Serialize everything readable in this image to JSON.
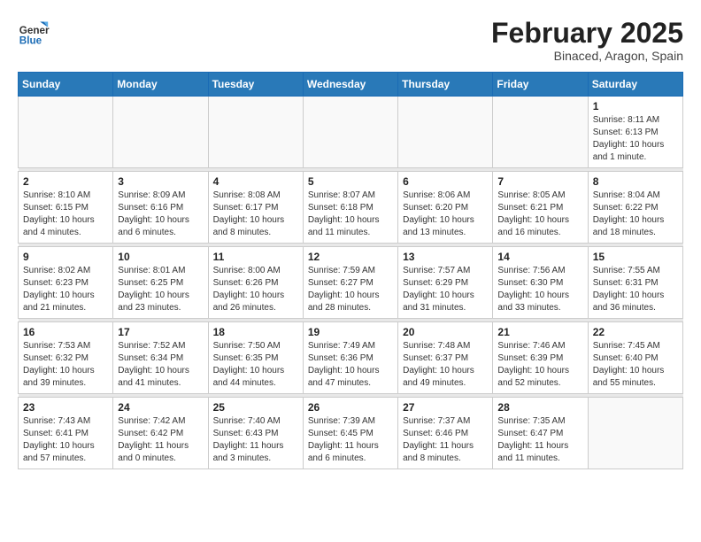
{
  "logo": {
    "general": "General",
    "blue": "Blue"
  },
  "title": "February 2025",
  "subtitle": "Binaced, Aragon, Spain",
  "weekdays": [
    "Sunday",
    "Monday",
    "Tuesday",
    "Wednesday",
    "Thursday",
    "Friday",
    "Saturday"
  ],
  "weeks": [
    [
      {
        "day": "",
        "info": ""
      },
      {
        "day": "",
        "info": ""
      },
      {
        "day": "",
        "info": ""
      },
      {
        "day": "",
        "info": ""
      },
      {
        "day": "",
        "info": ""
      },
      {
        "day": "",
        "info": ""
      },
      {
        "day": "1",
        "info": "Sunrise: 8:11 AM\nSunset: 6:13 PM\nDaylight: 10 hours and 1 minute."
      }
    ],
    [
      {
        "day": "2",
        "info": "Sunrise: 8:10 AM\nSunset: 6:15 PM\nDaylight: 10 hours and 4 minutes."
      },
      {
        "day": "3",
        "info": "Sunrise: 8:09 AM\nSunset: 6:16 PM\nDaylight: 10 hours and 6 minutes."
      },
      {
        "day": "4",
        "info": "Sunrise: 8:08 AM\nSunset: 6:17 PM\nDaylight: 10 hours and 8 minutes."
      },
      {
        "day": "5",
        "info": "Sunrise: 8:07 AM\nSunset: 6:18 PM\nDaylight: 10 hours and 11 minutes."
      },
      {
        "day": "6",
        "info": "Sunrise: 8:06 AM\nSunset: 6:20 PM\nDaylight: 10 hours and 13 minutes."
      },
      {
        "day": "7",
        "info": "Sunrise: 8:05 AM\nSunset: 6:21 PM\nDaylight: 10 hours and 16 minutes."
      },
      {
        "day": "8",
        "info": "Sunrise: 8:04 AM\nSunset: 6:22 PM\nDaylight: 10 hours and 18 minutes."
      }
    ],
    [
      {
        "day": "9",
        "info": "Sunrise: 8:02 AM\nSunset: 6:23 PM\nDaylight: 10 hours and 21 minutes."
      },
      {
        "day": "10",
        "info": "Sunrise: 8:01 AM\nSunset: 6:25 PM\nDaylight: 10 hours and 23 minutes."
      },
      {
        "day": "11",
        "info": "Sunrise: 8:00 AM\nSunset: 6:26 PM\nDaylight: 10 hours and 26 minutes."
      },
      {
        "day": "12",
        "info": "Sunrise: 7:59 AM\nSunset: 6:27 PM\nDaylight: 10 hours and 28 minutes."
      },
      {
        "day": "13",
        "info": "Sunrise: 7:57 AM\nSunset: 6:29 PM\nDaylight: 10 hours and 31 minutes."
      },
      {
        "day": "14",
        "info": "Sunrise: 7:56 AM\nSunset: 6:30 PM\nDaylight: 10 hours and 33 minutes."
      },
      {
        "day": "15",
        "info": "Sunrise: 7:55 AM\nSunset: 6:31 PM\nDaylight: 10 hours and 36 minutes."
      }
    ],
    [
      {
        "day": "16",
        "info": "Sunrise: 7:53 AM\nSunset: 6:32 PM\nDaylight: 10 hours and 39 minutes."
      },
      {
        "day": "17",
        "info": "Sunrise: 7:52 AM\nSunset: 6:34 PM\nDaylight: 10 hours and 41 minutes."
      },
      {
        "day": "18",
        "info": "Sunrise: 7:50 AM\nSunset: 6:35 PM\nDaylight: 10 hours and 44 minutes."
      },
      {
        "day": "19",
        "info": "Sunrise: 7:49 AM\nSunset: 6:36 PM\nDaylight: 10 hours and 47 minutes."
      },
      {
        "day": "20",
        "info": "Sunrise: 7:48 AM\nSunset: 6:37 PM\nDaylight: 10 hours and 49 minutes."
      },
      {
        "day": "21",
        "info": "Sunrise: 7:46 AM\nSunset: 6:39 PM\nDaylight: 10 hours and 52 minutes."
      },
      {
        "day": "22",
        "info": "Sunrise: 7:45 AM\nSunset: 6:40 PM\nDaylight: 10 hours and 55 minutes."
      }
    ],
    [
      {
        "day": "23",
        "info": "Sunrise: 7:43 AM\nSunset: 6:41 PM\nDaylight: 10 hours and 57 minutes."
      },
      {
        "day": "24",
        "info": "Sunrise: 7:42 AM\nSunset: 6:42 PM\nDaylight: 11 hours and 0 minutes."
      },
      {
        "day": "25",
        "info": "Sunrise: 7:40 AM\nSunset: 6:43 PM\nDaylight: 11 hours and 3 minutes."
      },
      {
        "day": "26",
        "info": "Sunrise: 7:39 AM\nSunset: 6:45 PM\nDaylight: 11 hours and 6 minutes."
      },
      {
        "day": "27",
        "info": "Sunrise: 7:37 AM\nSunset: 6:46 PM\nDaylight: 11 hours and 8 minutes."
      },
      {
        "day": "28",
        "info": "Sunrise: 7:35 AM\nSunset: 6:47 PM\nDaylight: 11 hours and 11 minutes."
      },
      {
        "day": "",
        "info": ""
      }
    ]
  ]
}
